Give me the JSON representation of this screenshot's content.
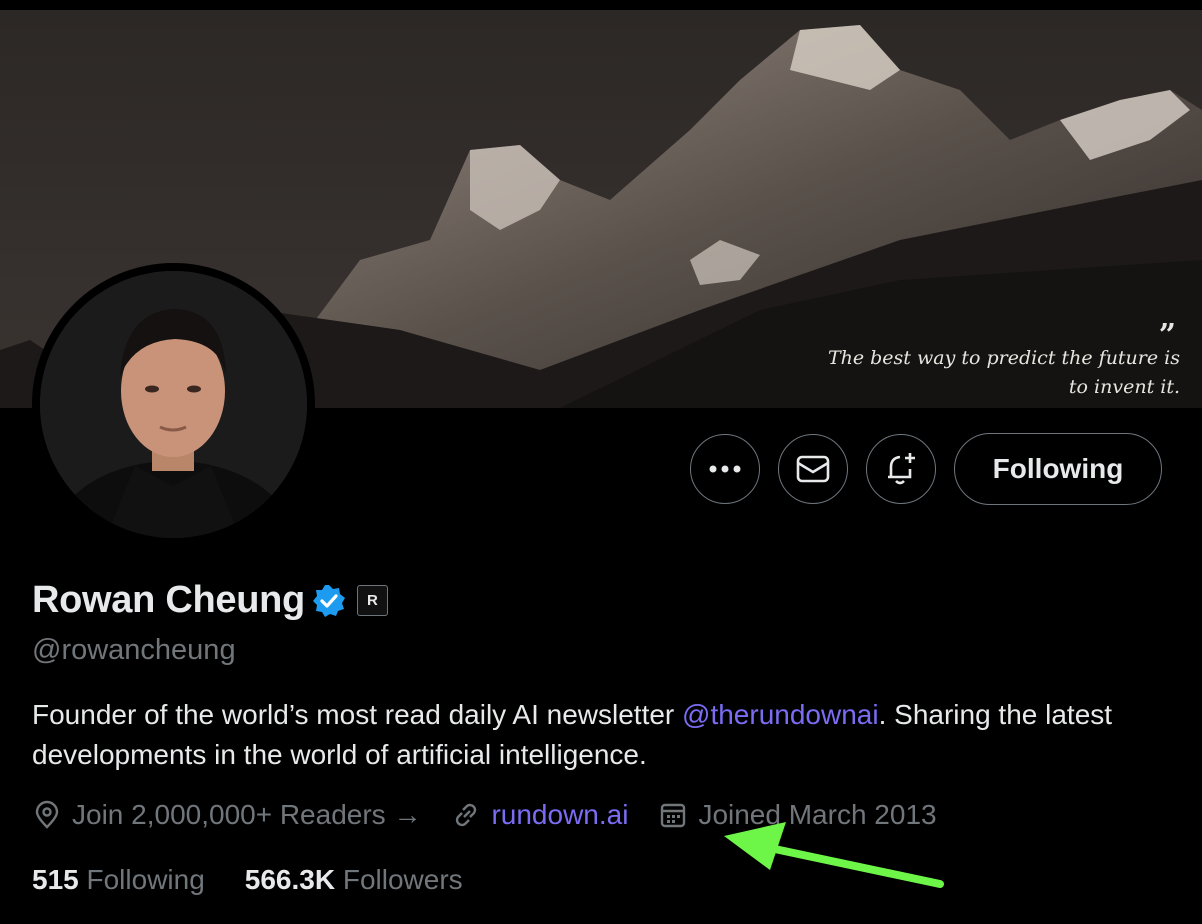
{
  "banner": {
    "quote_mark": "”",
    "quote_line1": "The best way to predict the future is",
    "quote_line2": "to invent it."
  },
  "actions": {
    "more_icon": "more-horizontal-icon",
    "message_icon": "envelope-icon",
    "notify_icon": "bell-plus-icon",
    "follow_label": "Following"
  },
  "profile": {
    "name": "Rowan Cheung",
    "verified_icon": "verified-badge-icon",
    "affiliate_badge": "R",
    "handle": "@rowancheung",
    "bio_before": "Founder of the world’s most read daily AI newsletter ",
    "bio_mention": "@therundownai",
    "bio_after": ". Sharing the latest developments in the world of artificial intelligence."
  },
  "meta": {
    "location": "Join 2,000,000+ Readers →",
    "website": "rundown.ai",
    "joined": "Joined March 2013"
  },
  "stats": {
    "following_count": "515",
    "following_label": "Following",
    "followers_count": "566.3K",
    "followers_label": "Followers"
  },
  "colors": {
    "accent": "#7a6cf3",
    "verified": "#1d9bf0",
    "arrow": "#6df548",
    "muted": "#71767b"
  }
}
